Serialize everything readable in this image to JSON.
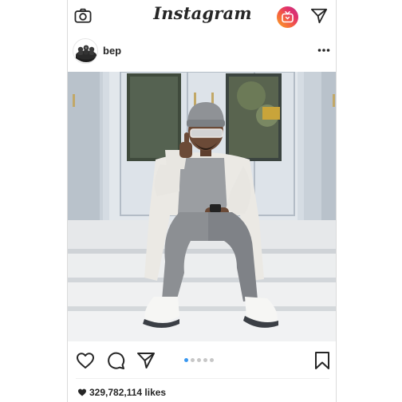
{
  "app": {
    "logo": "Instagram",
    "brand_colors": [
      "#f9a825",
      "#f56040",
      "#e1306c",
      "#c13584"
    ]
  },
  "topbar": {
    "icons": [
      "camera-icon",
      "igtv-icon",
      "direct-message-icon"
    ]
  },
  "post": {
    "username": "bep",
    "more_icon": "more-options-icon",
    "carousel": {
      "count": 5,
      "active_index": 0,
      "active_color": "#3897f0"
    },
    "actions": [
      "heart-icon",
      "comment-icon",
      "share-icon",
      "bookmark-icon"
    ],
    "likes_text": "329,782,114 likes"
  }
}
